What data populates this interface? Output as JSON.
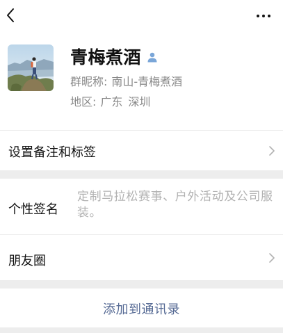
{
  "header": {
    "back_icon": "chevron-left-icon",
    "more_icon": "more-horizontal-icon"
  },
  "profile": {
    "avatar_icon": "profile-photo",
    "nickname": "青梅煮酒",
    "gender_icon": "user-gender-icon",
    "group_nickname_label": "群昵称:",
    "group_nickname_value": "南山-青梅煮酒",
    "region_label": "地区:",
    "region_province": "广东",
    "region_city": "深圳"
  },
  "rows": {
    "remark_label": "设置备注和标签",
    "signature_label": "个性签名",
    "signature_value": "定制马拉松赛事、户外活动及公司服装。",
    "moments_label": "朋友圈"
  },
  "actions": {
    "add_contact_label": "添加到通讯录"
  },
  "colors": {
    "background": "#ededed",
    "link_blue": "#576b95",
    "secondary_text": "#888888",
    "placeholder_text": "#b2b2b2",
    "gender_icon_blue": "#7aa6d8"
  }
}
